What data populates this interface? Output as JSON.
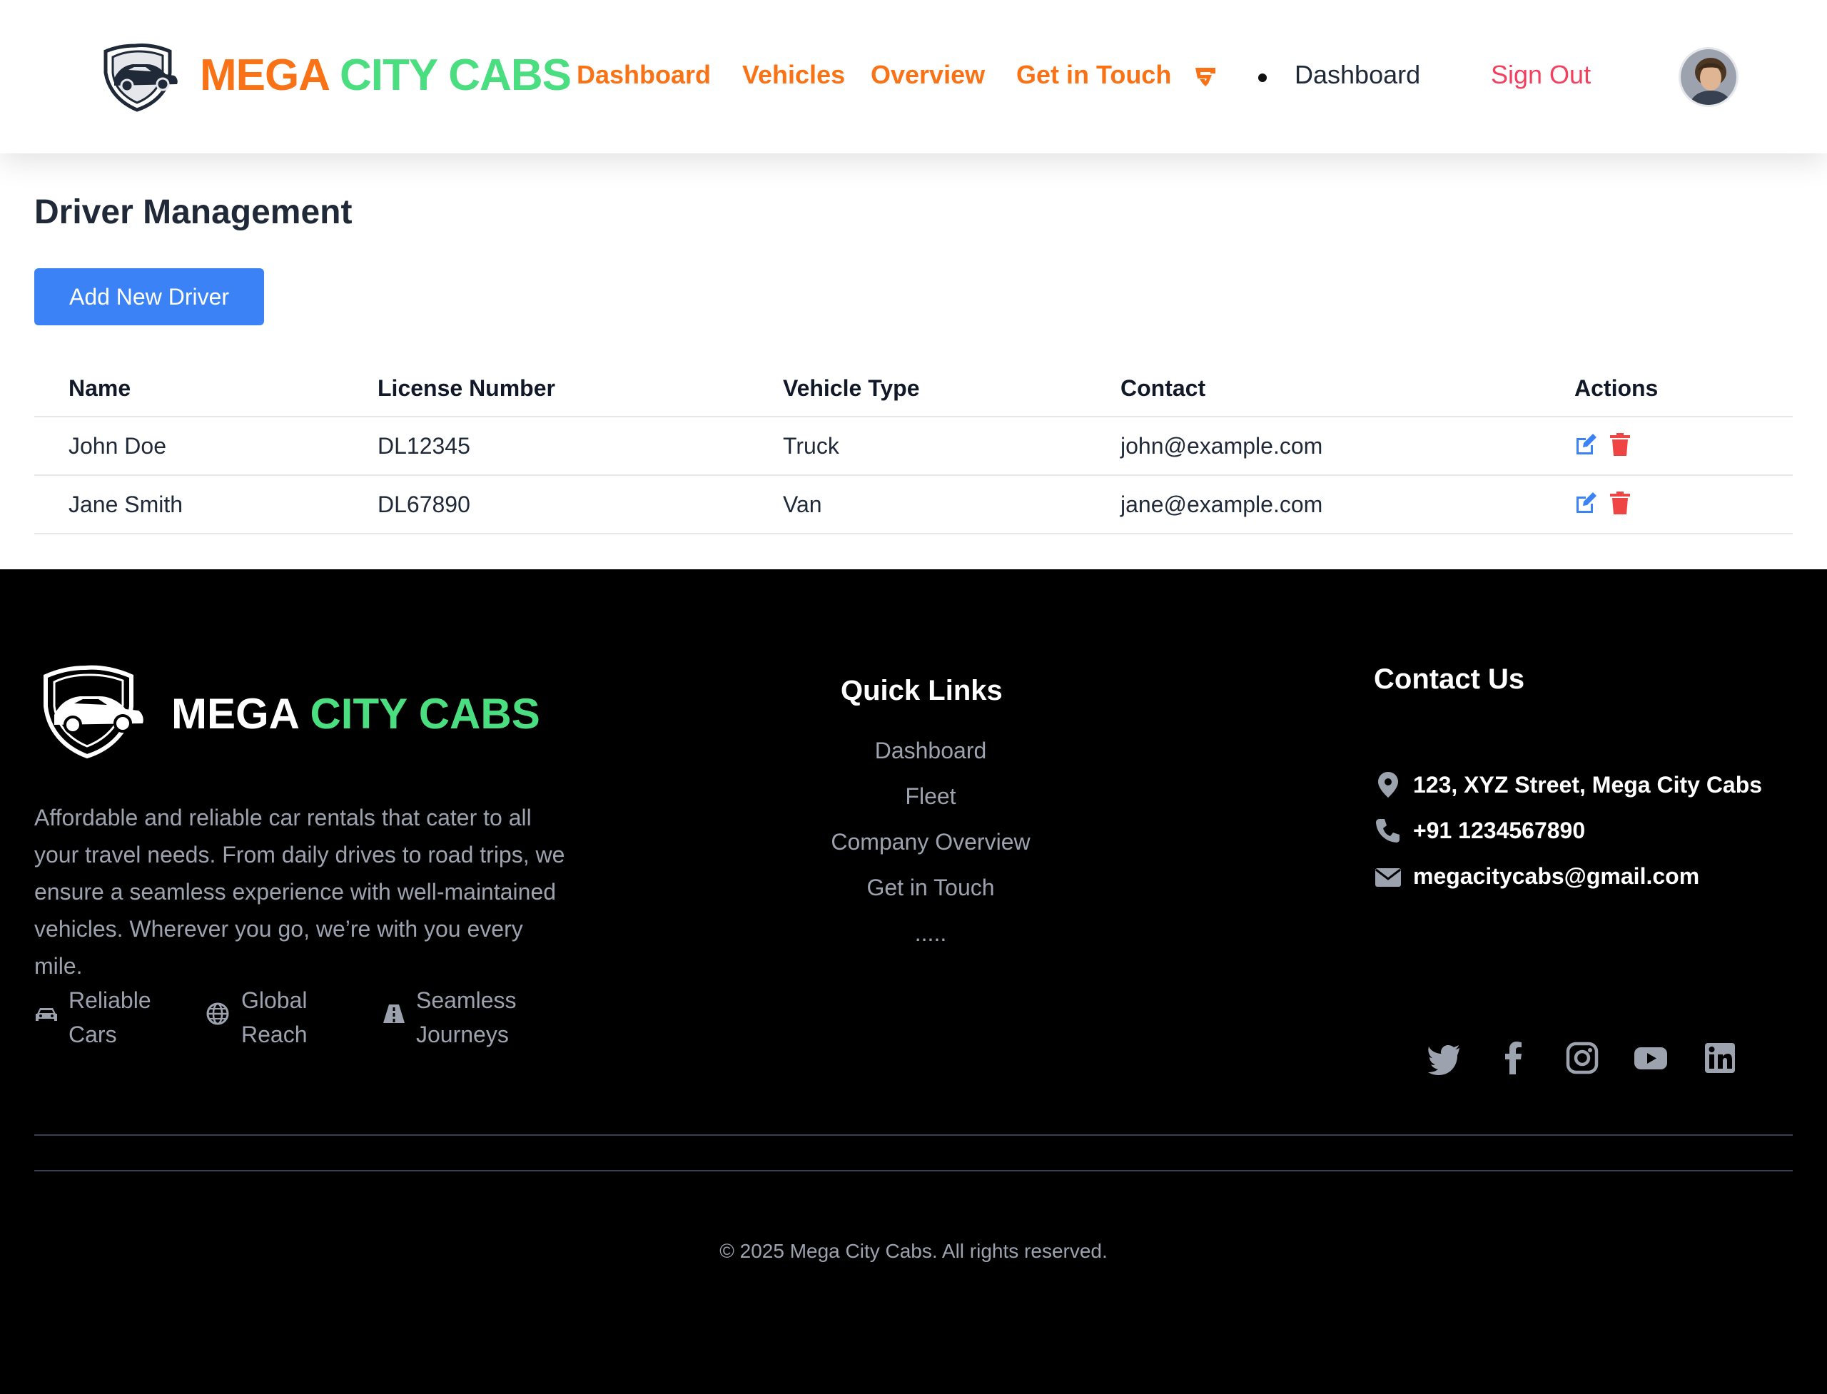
{
  "header": {
    "brand_mega": "MEGA",
    "brand_city": "CITY CABS",
    "nav": [
      "Dashboard",
      "Vehicles",
      "Overview",
      "Get in Touch"
    ],
    "nav_active": "Dashboard",
    "sign_out": "Sign Out"
  },
  "main": {
    "title": "Driver Management",
    "add_button": "Add New Driver",
    "columns": [
      "Name",
      "License Number",
      "Vehicle Type",
      "Contact",
      "Actions"
    ],
    "rows": [
      {
        "name": "John Doe",
        "license": "DL12345",
        "vehicle": "Truck",
        "contact": "john@example.com"
      },
      {
        "name": "Jane Smith",
        "license": "DL67890",
        "vehicle": "Van",
        "contact": "jane@example.com"
      }
    ]
  },
  "footer": {
    "brand_mega": "MEGA",
    "brand_city": "CITY CABS",
    "description": "Affordable and reliable car rentals that cater to all your travel needs. From daily drives to road trips, we ensure a seamless experience with well-maintained vehicles. Wherever you go, we’re with you every mile.",
    "features": [
      {
        "line1": "Reliable",
        "line2": "Cars",
        "icon": "car-icon"
      },
      {
        "line1": "Global",
        "line2": "Reach",
        "icon": "globe-icon"
      },
      {
        "line1": "Seamless",
        "line2": "Journeys",
        "icon": "road-icon"
      }
    ],
    "quick_links_title": "Quick Links",
    "quick_links": [
      "Dashboard",
      "Fleet",
      "Company Overview",
      "Get in Touch",
      "....."
    ],
    "contact_title": "Contact Us",
    "address": "123, XYZ Street, Mega City Cabs",
    "phone": "+91 1234567890",
    "email": "megacitycabs@gmail.com",
    "social": [
      "twitter-icon",
      "facebook-icon",
      "instagram-icon",
      "youtube-icon",
      "linkedin-icon"
    ],
    "copyright": "© 2025 Mega City Cabs. All rights reserved."
  },
  "colors": {
    "brand_orange": "#f97316",
    "brand_green": "#4ade80",
    "primary_blue": "#3b82f6",
    "danger_red": "#ef4444",
    "sign_out": "#f43f5e"
  }
}
